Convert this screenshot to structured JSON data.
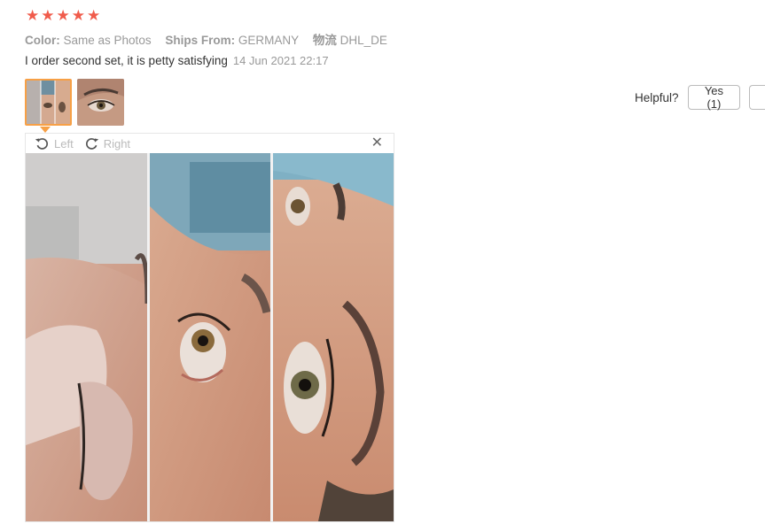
{
  "rating": {
    "stars": 5,
    "star_color": "#f05b4b"
  },
  "attributes": {
    "color_key": "Color:",
    "color_value": "Same as Photos",
    "ships_key": "Ships From:",
    "ships_value": "GERMANY",
    "logistics_key": "物流",
    "logistics_value": "DHL_DE"
  },
  "review": {
    "text": "I order second set, it is petty satisfying",
    "date": "14 Jun 2021 22:17"
  },
  "helpful": {
    "label": "Helpful?",
    "yes_button": "Yes (1)"
  },
  "viewer": {
    "rotate_left": "Left",
    "rotate_right": "Right",
    "close_icon": "close-icon"
  },
  "colors": {
    "accent": "#f7a046",
    "muted": "#999999"
  }
}
